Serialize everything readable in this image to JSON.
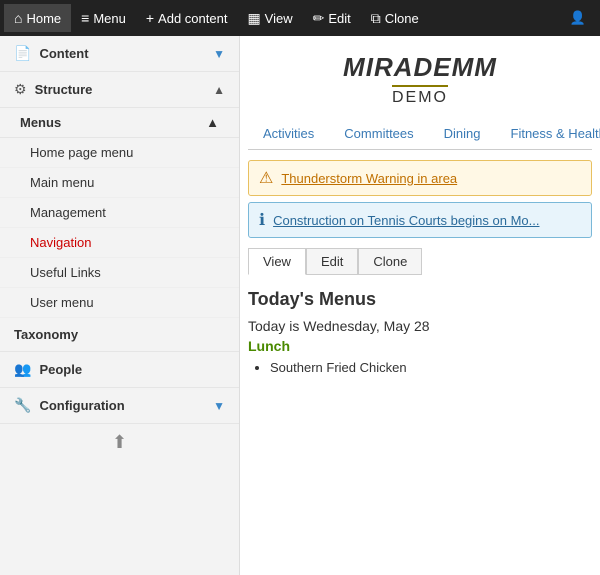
{
  "topnav": {
    "items": [
      {
        "label": "Home",
        "icon": "⌂",
        "active": false
      },
      {
        "label": "Menu",
        "icon": "≡",
        "active": true
      },
      {
        "label": "Add content",
        "icon": "+",
        "active": false
      },
      {
        "label": "View",
        "icon": "🖼",
        "active": false
      },
      {
        "label": "Edit",
        "icon": "✏",
        "active": false
      },
      {
        "label": "Clone",
        "icon": "📋",
        "active": false
      }
    ],
    "user_icon": "👤"
  },
  "sidebar": {
    "items": [
      {
        "label": "Content",
        "icon": "📄",
        "arrow": "▼",
        "arrow_blue": true
      },
      {
        "label": "Structure",
        "icon": "⚙",
        "arrow": "▲",
        "arrow_blue": false
      }
    ],
    "submenu": {
      "group_label": "Menus",
      "group_arrow": "▲",
      "children": [
        {
          "label": "Home page menu",
          "active": false
        },
        {
          "label": "Main menu",
          "active": false
        },
        {
          "label": "Management",
          "active": false
        },
        {
          "label": "Navigation",
          "active": true
        },
        {
          "label": "Useful Links",
          "active": false
        },
        {
          "label": "User menu",
          "active": false
        }
      ]
    },
    "taxonomy_label": "Taxonomy",
    "people_label": "People",
    "people_icon": "👤",
    "config_label": "Configuration",
    "config_icon": "🔧",
    "config_arrow": "▼",
    "upload_icon": "⬆"
  },
  "main": {
    "logo_text_m": "M",
    "logo_text_iradem": "iradem",
    "logo_text_m2": "M",
    "logo_demo": "DEMO",
    "tabs": [
      {
        "label": "Activities",
        "active": false
      },
      {
        "label": "Committees",
        "active": false
      },
      {
        "label": "Dining",
        "active": false
      },
      {
        "label": "Fitness & Health",
        "active": false
      }
    ],
    "alerts": [
      {
        "type": "warning",
        "icon": "⚠",
        "text": "Thunderstorm Warning in area"
      },
      {
        "type": "info",
        "icon": "ℹ",
        "text": "Construction on Tennis Courts begins on Mo..."
      }
    ],
    "action_buttons": [
      {
        "label": "View",
        "active": true
      },
      {
        "label": "Edit",
        "active": false
      },
      {
        "label": "Clone",
        "active": false
      }
    ],
    "section_title": "Today's Menus",
    "date_text": "Today is Wednesday, May 28",
    "meal_title": "Lunch",
    "menu_items": [
      "Southern Fried Chicken"
    ]
  }
}
